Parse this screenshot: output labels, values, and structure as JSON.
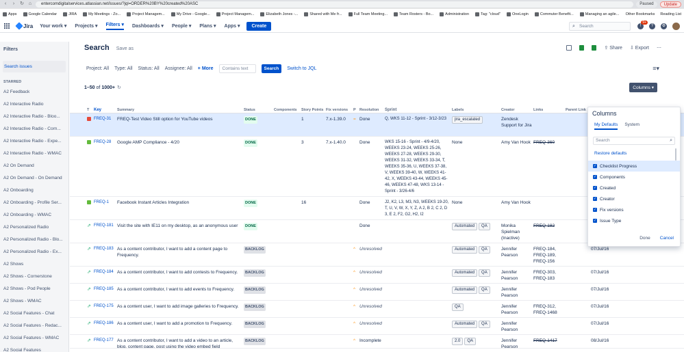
{
  "browser": {
    "url": "entercomdigitalservices.atlassian.net/issues/?jql=ORDER%20BY%20created%20ASC",
    "paused": "Paused",
    "update": "Update",
    "bookmarks": [
      "Apps",
      "Google Calendar",
      "JIRA",
      "My Meetings - Zo...",
      "Project Managem...",
      "My Drive - Google...",
      "Project Managem...",
      "Elizabeth Jones -...",
      "Shared with Me fr...",
      "Full Team Meeting...",
      "Team Rosters - Bo...",
      "Administration",
      "Tag: \"cloud\"",
      "OneLogin",
      "Commuter Benefit...",
      "Managing an agile..."
    ],
    "other_bookmarks": "Other Bookmarks",
    "reading_list": "Reading List"
  },
  "nav": {
    "logo": "Jira",
    "items": [
      "Your work",
      "Projects",
      "Filters",
      "Dashboards",
      "People",
      "Plans",
      "Apps"
    ],
    "active": "Filters",
    "create": "Create",
    "search_placeholder": "Search",
    "notif_count": "9+"
  },
  "sidebar": {
    "title": "Filters",
    "active": "Search issues",
    "section": "STARRED",
    "items": [
      "A2 Feedback",
      "A2 Interactive Radio",
      "A2 Interactive Radio - Bloo...",
      "A2 Interactive Radio - Corn...",
      "A2 Interactive Radio - Expe...",
      "A2 Interactive Radio - WMAC",
      "A2 On Demand",
      "A2 On Demand - On Demand",
      "A2 Onboarding",
      "A2 Onboarding - Profile Ser...",
      "A2 Onboarding - WMAC",
      "A2 Personalized Radio",
      "A2 Personalized Radio - Blo...",
      "A2 Personalized Radio - Ex...",
      "A2 Shows",
      "A2 Shows - Cornerstone",
      "A2 Shows - Pod People",
      "A2 Shows - WMAC",
      "A2 Social Features - Chat",
      "A2 Social Features - Redac...",
      "A2 Social Features - WMAC",
      "A2 Social Features"
    ]
  },
  "main": {
    "title": "Search",
    "save_as": "Save as",
    "share": "Share",
    "export": "Export",
    "filters": [
      "Project: All",
      "Type: All",
      "Status: All",
      "Assignee: All"
    ],
    "more": "+ More",
    "contains_placeholder": "Contains text",
    "search_button": "Search",
    "switch_jql": "Switch to JQL",
    "count_range": "1–50",
    "count_of": "of",
    "count_total": "1000+",
    "columns_button": "Columns"
  },
  "table": {
    "headers": [
      "T",
      "Key",
      "Summary",
      "Status",
      "Components",
      "Story Points",
      "Fix versions",
      "P",
      "Resolution",
      "Sprint",
      "Labels",
      "Creator",
      "Links",
      "Parent Link"
    ],
    "rows": [
      {
        "type": "bug",
        "key": "FREQ-31",
        "summary": "FREQ-Test Video Still option for YouTube videos",
        "status": "DONE",
        "sp": "1",
        "fix": "7.x-1.39.0",
        "res": "Done",
        "sprint": "Q, WKS 11-12 - Sprint - 3/12-3/23",
        "labels": [
          "jira_escalated"
        ],
        "creator": "Zendesk Support for Jira",
        "links": "",
        "date": ""
      },
      {
        "type": "story",
        "key": "FREQ-28",
        "summary": "Google AMP Compliance - 4/20",
        "status": "DONE",
        "sp": "3",
        "fix": "7.x-1.40.0",
        "res": "Done",
        "sprint": "WKS 15-16 - Sprint - 4/9-4/20, WEEKS 23-24, WEEKS 25-26, WEEKS 27-28, WEEKS 29-30, WEEKS 31-32, WEEKS 33-34, T, WEEKS 35-36, U, WEEKS 37-38, V, WEEKS 39-40, W, WEEKS 41-42, X, WEEKS 43-44, WEEKS 45-46, WEEKS 47-48, WKS 13-14 - Sprint - 3/26-4/6",
        "labels_text": "None",
        "creator": "Amy Van Hook",
        "links": "FREQ-360",
        "date": ""
      },
      {
        "type": "story",
        "key": "FREQ-1",
        "summary": "Facebook Instant Articles Integration",
        "status": "DONE",
        "sp": "16",
        "fix": "",
        "res": "Done",
        "sprint": "J2, K2, L3, M3, N3, WEEKS 19-20, T, U, V, W, X, Y, Z, A 2, B 2, C 2, D 3, E 2, F2, G2, H2, I2",
        "labels_text": "None",
        "creator": "Amy Van Hook",
        "links": "",
        "date": ""
      },
      {
        "type": "sub",
        "key": "FREQ-181",
        "summary": "Visit the site with IE11 on my desktop, as an anonymous user",
        "status": "DONE",
        "sp": "",
        "fix": "",
        "res": "Done",
        "sprint": "",
        "labels": [
          "Automated",
          "QA"
        ],
        "creator": "Monika Spielman (Inactive)",
        "links": "FREQ-182",
        "date": ""
      },
      {
        "type": "sub",
        "key": "FREQ-183",
        "summary": "As a content contributor, I want to add a content page to Frequency.",
        "status": "BACKLOG",
        "sp": "",
        "fix": "",
        "res": "Unresolved",
        "sprint": "",
        "labels": [
          "Automated",
          "QA"
        ],
        "creator": "Jennifer Pearson",
        "links": "FREQ-184, FREQ-189, FREQ-156",
        "date": "07/Jul/16"
      },
      {
        "type": "sub",
        "key": "FREQ-184",
        "summary": "As a content contributor, I want to add contests to Frequency.",
        "status": "BACKLOG",
        "sp": "",
        "fix": "",
        "res": "Unresolved",
        "sprint": "",
        "labels": [
          "Automated",
          "QA"
        ],
        "creator": "Jennifer Pearson",
        "links": "FREQ-303, FREQ-183",
        "date": "07/Jul/16"
      },
      {
        "type": "sub",
        "key": "FREQ-185",
        "summary": "As a content contributor, I want to add events to Frequency.",
        "status": "BACKLOG",
        "sp": "",
        "fix": "",
        "res": "Unresolved",
        "sprint": "",
        "labels": [
          "Automated",
          "QA"
        ],
        "creator": "Jennifer Pearson",
        "links": "",
        "date": "07/Jul/16"
      },
      {
        "type": "sub",
        "key": "FREQ-175",
        "summary": "As a content user, I want to add image galleries to Frequency.",
        "status": "BACKLOG",
        "sp": "",
        "fix": "",
        "res": "Unresolved",
        "sprint": "",
        "labels": [
          "QA"
        ],
        "creator": "Jennifer Pearson",
        "links": "FREQ-312, FREQ-1468",
        "date": "07/Jul/16"
      },
      {
        "type": "sub",
        "key": "FREQ-186",
        "summary": "As a content user, I want to add a promotion to Frequency.",
        "status": "BACKLOG",
        "sp": "",
        "fix": "",
        "res": "Unresolved",
        "sprint": "",
        "labels": [
          "Automated",
          "QA"
        ],
        "creator": "Jennifer Pearson",
        "links": "",
        "date": "07/Jul/16"
      },
      {
        "type": "sub",
        "key": "FREQ-177",
        "summary": "As a content contributor, I want to add a video to an article, blog, content page, post using the video embed field",
        "status": "BACKLOG",
        "sp": "",
        "fix": "",
        "res": "Incomplete",
        "sprint": "",
        "labels": [
          "2.0",
          "QA"
        ],
        "creator": "Jennifer Pearson",
        "links": "FREQ-1417",
        "date": "08/Jul/16"
      }
    ]
  },
  "columns_panel": {
    "title": "Columns",
    "tabs": [
      "My Defaults",
      "System"
    ],
    "search_placeholder": "Search",
    "restore": "Restore defaults",
    "items": [
      "Checklist Progress",
      "Components",
      "Created",
      "Creator",
      "Fix versions",
      "Issue Type"
    ],
    "done": "Done",
    "cancel": "Cancel"
  },
  "colors": {
    "primary": "#0052cc",
    "done_bg": "#e3fcef",
    "selected_row": "#deebff"
  }
}
